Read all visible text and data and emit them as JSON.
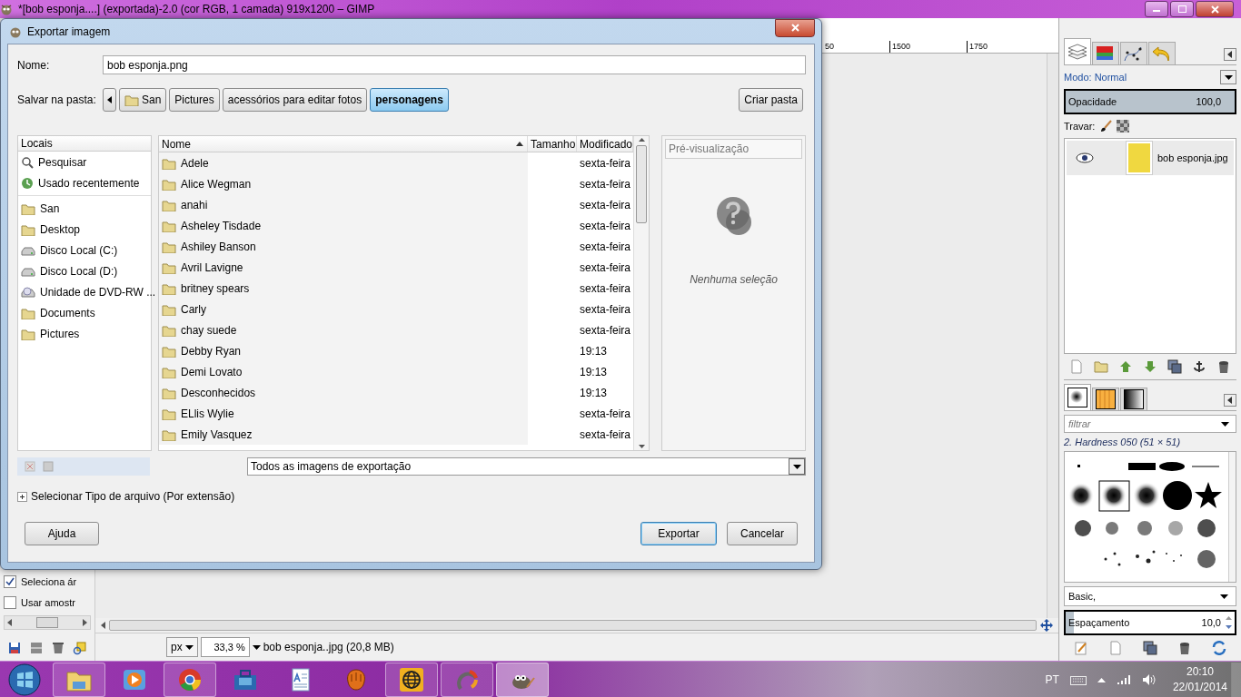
{
  "window": {
    "title": "*[bob esponja....] (exportada)-2.0 (cor RGB, 1 camada) 919x1200 – GIMP"
  },
  "ruler": {
    "labels": [
      "50",
      "1500",
      "1750"
    ]
  },
  "toolbox": {
    "options": [
      {
        "label": "Seleciona ár",
        "checked": true
      },
      {
        "label": "Usar amostr",
        "checked": false
      }
    ]
  },
  "status_bar": {
    "unit": "px",
    "zoom": "33,3 %",
    "info": "bob esponja..jpg (20,8 MB)"
  },
  "layers_dock": {
    "tabs": [
      {
        "kind": "layers",
        "selected": true
      },
      {
        "kind": "channels",
        "selected": false
      },
      {
        "kind": "paths",
        "selected": false
      },
      {
        "kind": "undo",
        "selected": false
      }
    ],
    "mode_label": "Modo:",
    "mode": "Normal",
    "opacity": {
      "label": "Opacidade",
      "value": "100,0",
      "level": 1
    },
    "lock_label": "Travar:",
    "layers": [
      {
        "name": "bob esponja.jpg",
        "visible": true,
        "selected": true
      }
    ]
  },
  "brushes_dock": {
    "tabs": [
      {
        "kind": "brushes",
        "selected": true
      },
      {
        "kind": "patterns",
        "selected": false
      },
      {
        "kind": "gradients",
        "selected": false
      }
    ],
    "filter_placeholder": "filtrar",
    "brush_name": "2. Hardness 050 (51 × 51)",
    "preset": "Basic,",
    "spacing": {
      "label": "Espaçamento",
      "value": "10,0",
      "level": 0.05
    }
  },
  "dialog": {
    "title": "Exportar imagem",
    "name_label": "Nome:",
    "name_value": "bob esponja.png",
    "folder_label": "Salvar na pasta:",
    "path": [
      {
        "label": "San",
        "selected": false
      },
      {
        "label": "Pictures",
        "selected": false
      },
      {
        "label": "acessórios para editar fotos",
        "selected": false
      },
      {
        "label": "personagens",
        "selected": true
      }
    ],
    "create_folder": "Criar pasta",
    "places_header": "Locais",
    "places": [
      {
        "label": "Pesquisar",
        "kind": "search"
      },
      {
        "label": "Usado recentemente",
        "kind": "recent"
      },
      {
        "label": "San",
        "kind": "home"
      },
      {
        "label": "Desktop",
        "kind": "desktop"
      },
      {
        "label": "Disco Local (C:)",
        "kind": "drive"
      },
      {
        "label": "Disco Local (D:)",
        "kind": "drive"
      },
      {
        "label": "Unidade de DVD-RW ...",
        "kind": "dvd"
      },
      {
        "label": "Documents",
        "kind": "folder"
      },
      {
        "label": "Pictures",
        "kind": "folder"
      }
    ],
    "columns": [
      "Nome",
      "Tamanho",
      "Modificado"
    ],
    "files": [
      {
        "name": "Adele",
        "modified": "sexta-feira"
      },
      {
        "name": "Alice Wegman",
        "modified": "sexta-feira"
      },
      {
        "name": "anahi",
        "modified": "sexta-feira"
      },
      {
        "name": "Asheley Tisdade",
        "modified": "sexta-feira"
      },
      {
        "name": "Ashiley Banson",
        "modified": "sexta-feira"
      },
      {
        "name": "Avril Lavigne",
        "modified": "sexta-feira"
      },
      {
        "name": "britney spears",
        "modified": "sexta-feira"
      },
      {
        "name": "Carly",
        "modified": "sexta-feira"
      },
      {
        "name": "chay suede",
        "modified": "sexta-feira"
      },
      {
        "name": "Debby Ryan",
        "modified": "19:13"
      },
      {
        "name": "Demi Lovato",
        "modified": "19:13"
      },
      {
        "name": "Desconhecidos",
        "modified": "19:13"
      },
      {
        "name": "ELlis Wylie",
        "modified": "sexta-feira"
      },
      {
        "name": "Emily Vasquez",
        "modified": "sexta-feira"
      }
    ],
    "preview_header": "Pré-visualização",
    "preview_empty": "Nenhuma seleção",
    "filter": "Todos as imagens de exportação",
    "expander": {
      "label": "Selecionar Tipo de arquivo (Por extensão)",
      "expanded": false
    },
    "buttons": [
      {
        "label": "Ajuda",
        "kind": "help"
      },
      {
        "label": "Exportar",
        "kind": "default"
      },
      {
        "label": "Cancelar",
        "kind": "normal"
      }
    ]
  },
  "taskbar": {
    "apps": [
      {
        "kind": "folder",
        "running": true,
        "selected": false
      },
      {
        "kind": "media",
        "running": false,
        "selected": false
      },
      {
        "kind": "browser",
        "running": true,
        "selected": false
      },
      {
        "kind": "toolbox",
        "running": false,
        "selected": false
      },
      {
        "kind": "document",
        "running": false,
        "selected": false
      },
      {
        "kind": "glove",
        "running": false,
        "selected": false
      },
      {
        "kind": "globe",
        "running": true,
        "selected": false
      },
      {
        "kind": "ring",
        "running": true,
        "selected": false
      },
      {
        "kind": "gimp",
        "running": true,
        "selected": true
      }
    ],
    "language": "PT",
    "time": "20:10",
    "date": "22/01/2014"
  }
}
